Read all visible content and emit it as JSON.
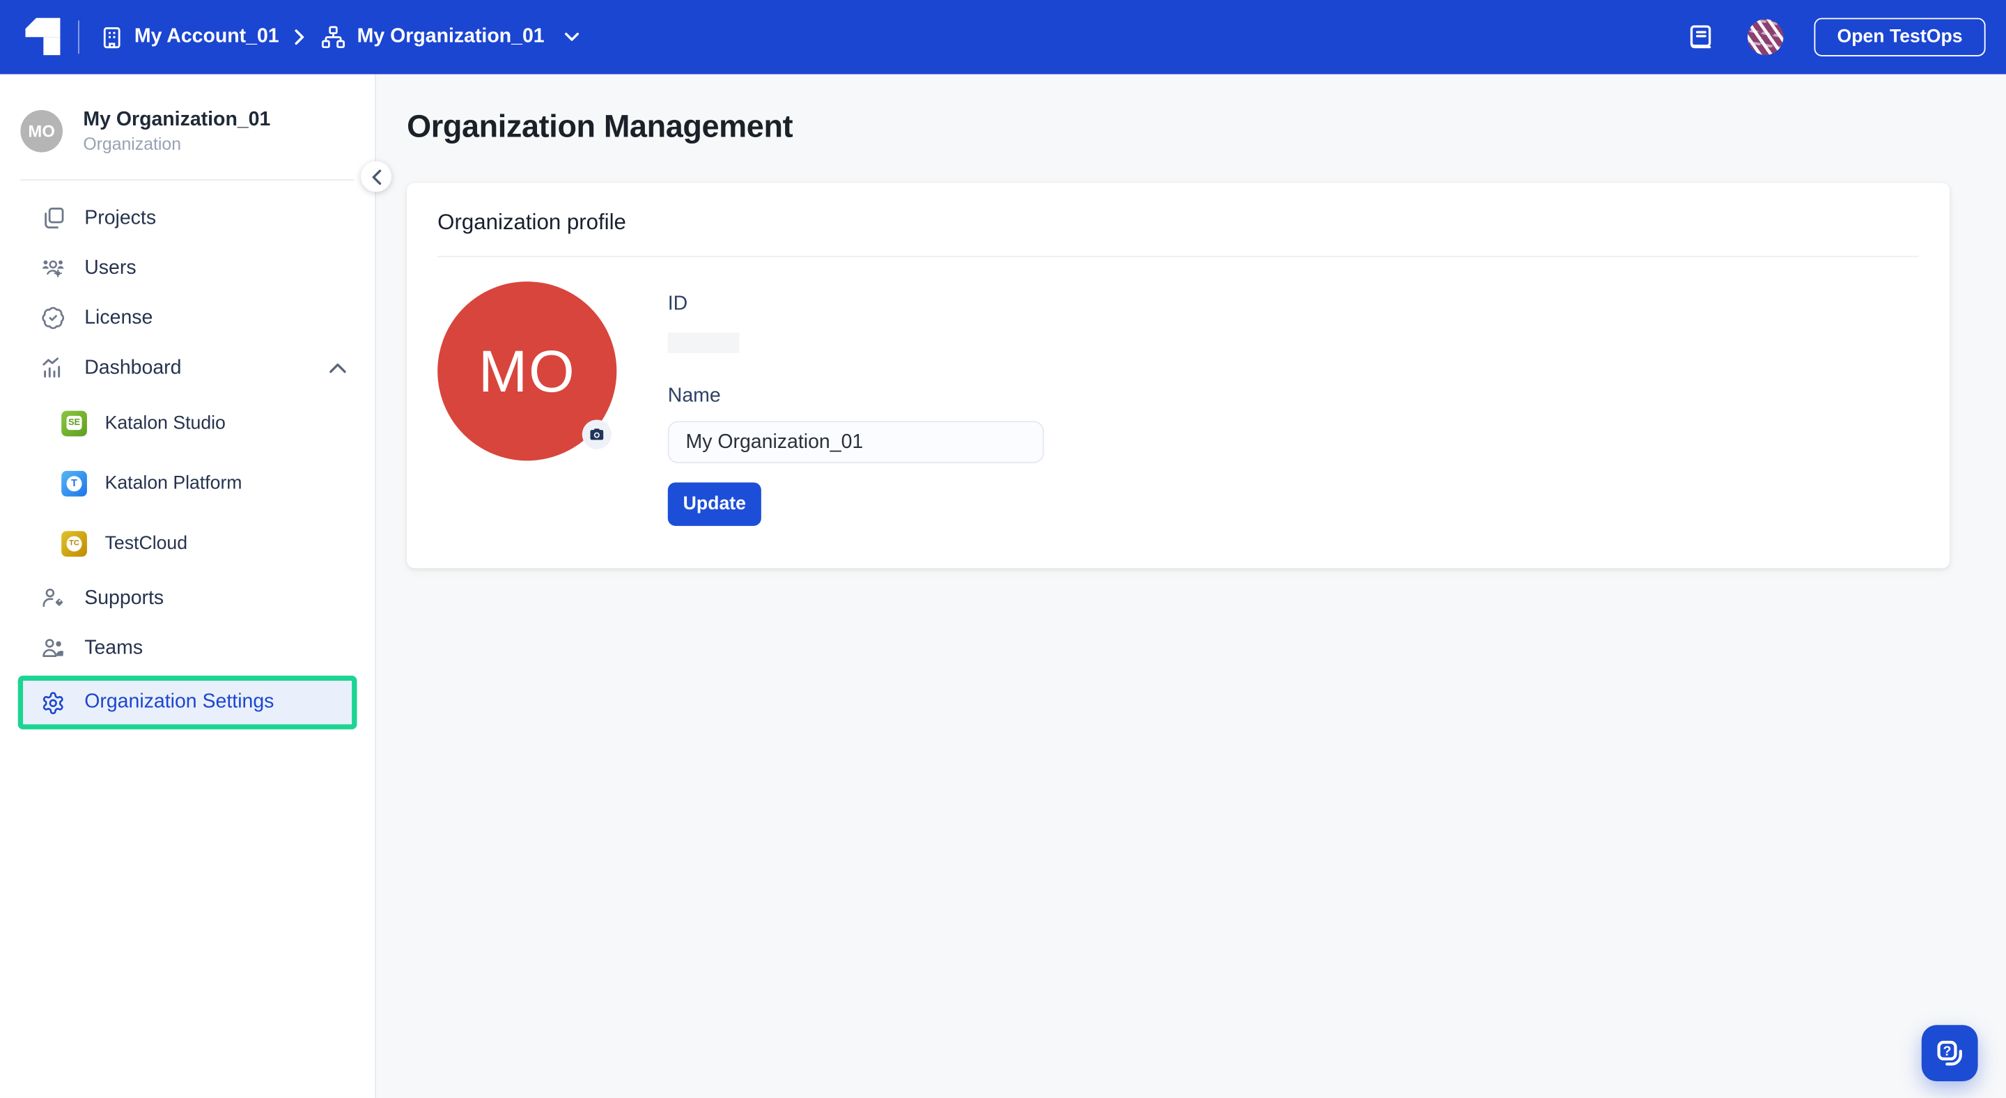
{
  "topbar": {
    "account_label": "My Account_01",
    "organization_label": "My Organization_01",
    "open_testops_label": "Open TestOps"
  },
  "sidebar": {
    "org_initials": "MO",
    "org_name": "My Organization_01",
    "org_subtitle": "Organization",
    "items": {
      "projects": "Projects",
      "users": "Users",
      "license": "License",
      "dashboard": "Dashboard",
      "katalon_studio": "Katalon Studio",
      "katalon_platform": "Katalon Platform",
      "testcloud": "TestCloud",
      "supports": "Supports",
      "teams": "Teams",
      "organization_settings": "Organization Settings"
    },
    "badges": {
      "studio": "SE",
      "platform": "T",
      "testcloud": "TC"
    }
  },
  "main": {
    "page_title": "Organization Management",
    "profile": {
      "section_title": "Organization profile",
      "avatar_initials": "MO",
      "id_label": "ID",
      "name_label": "Name",
      "name_value": "My Organization_01",
      "update_label": "Update"
    }
  },
  "colors": {
    "topbar_blue": "#1B46D2",
    "primary_blue": "#1D4ED8",
    "active_highlight_green": "#1CD493",
    "active_item_bg": "#EAF0FB",
    "avatar_red": "#D8453C",
    "sidebar_text": "#26334D"
  }
}
